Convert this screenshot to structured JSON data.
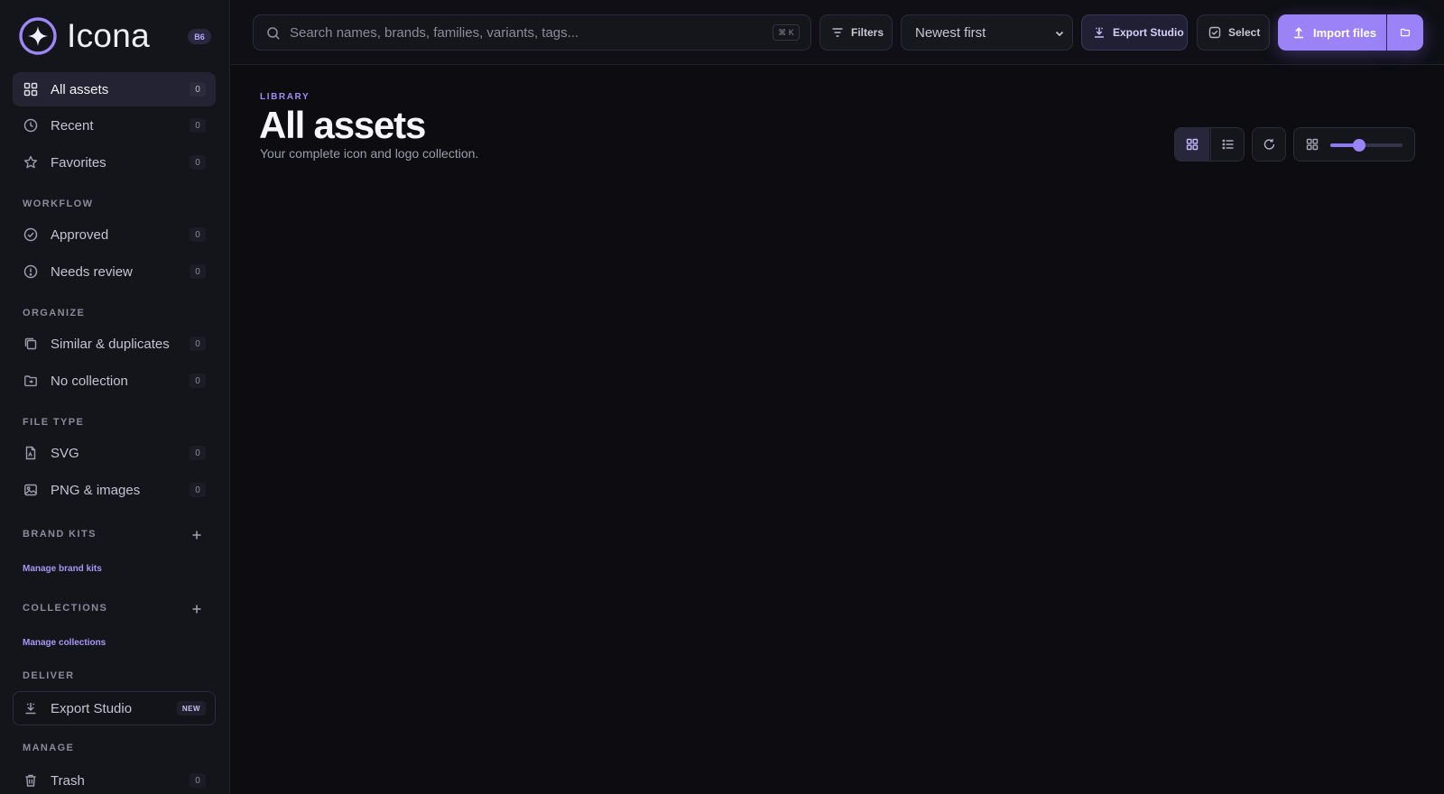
{
  "app": {
    "name": "Icona",
    "version_badge": "B6"
  },
  "sidebar": {
    "main_items": [
      {
        "label": "All assets",
        "count": "0",
        "icon": "grid-icon",
        "active": true
      },
      {
        "label": "Recent",
        "count": "0",
        "icon": "clock-icon"
      },
      {
        "label": "Favorites",
        "count": "0",
        "icon": "star-icon"
      }
    ],
    "workflow": {
      "title": "WORKFLOW",
      "items": [
        {
          "label": "Approved",
          "count": "0",
          "icon": "check-circle-icon"
        },
        {
          "label": "Needs review",
          "count": "0",
          "icon": "alert-circle-icon"
        }
      ]
    },
    "organize": {
      "title": "ORGANIZE",
      "items": [
        {
          "label": "Similar & duplicates",
          "count": "0",
          "icon": "copy-icon"
        },
        {
          "label": "No collection",
          "count": "0",
          "icon": "folder-icon"
        }
      ]
    },
    "file_type": {
      "title": "FILE TYPE",
      "items": [
        {
          "label": "SVG",
          "count": "0",
          "icon": "file-svg-icon"
        },
        {
          "label": "PNG & images",
          "count": "0",
          "icon": "image-icon"
        }
      ]
    },
    "brand_kits": {
      "title": "BRAND KITS",
      "manage_label": "Manage brand kits"
    },
    "collections": {
      "title": "COLLECTIONS",
      "manage_label": "Manage collections"
    },
    "deliver": {
      "title": "DELIVER",
      "item_label": "Export Studio",
      "badge": "NEW"
    },
    "manage": {
      "title": "MANAGE",
      "item_label": "Trash",
      "count": "0"
    }
  },
  "topbar": {
    "search_placeholder": "Search names, brands, families, variants, tags...",
    "search_shortcut": "⌘ K",
    "filters_label": "Filters",
    "sort_value": "Newest first",
    "export_label": "Export Studio",
    "select_label": "Select",
    "import_label": "Import files"
  },
  "main": {
    "eyebrow": "LIBRARY",
    "title": "All assets",
    "subtitle": "Your complete icon and logo collection.",
    "thumbnail_size_level": 0.4
  },
  "colors": {
    "accent": "#9b83f7",
    "background": "#0c0c11",
    "sidebar": "#14141b"
  }
}
